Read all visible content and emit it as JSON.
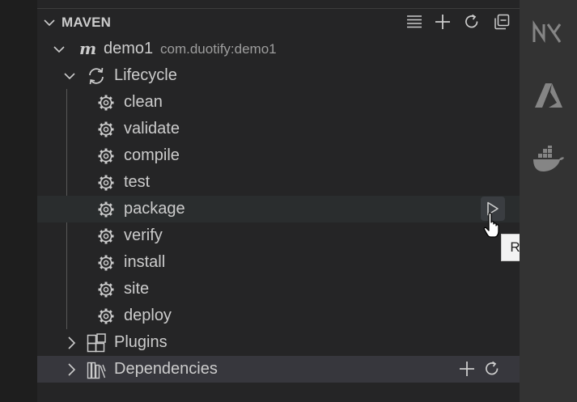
{
  "section": {
    "title": "MAVEN",
    "actions": [
      "list-icon",
      "add-icon",
      "refresh-icon",
      "collapse-all-icon"
    ]
  },
  "project": {
    "name": "demo1",
    "description": "com.duotify:demo1"
  },
  "lifecycle": {
    "label": "Lifecycle",
    "goals": [
      "clean",
      "validate",
      "compile",
      "test",
      "package",
      "verify",
      "install",
      "site",
      "deploy"
    ]
  },
  "plugins": {
    "label": "Plugins"
  },
  "dependencies": {
    "label": "Dependencies"
  },
  "tooltip": {
    "text": "Run"
  },
  "activity_bar": {
    "icons": [
      "nx-icon",
      "azure-icon",
      "docker-icon"
    ]
  },
  "colors": {
    "background": "#252526",
    "hover_row": "#2a2d2e",
    "selected_row": "#37373d",
    "text": "#cccccc",
    "description": "#9d9d9d",
    "activity_bar": "#333333"
  }
}
